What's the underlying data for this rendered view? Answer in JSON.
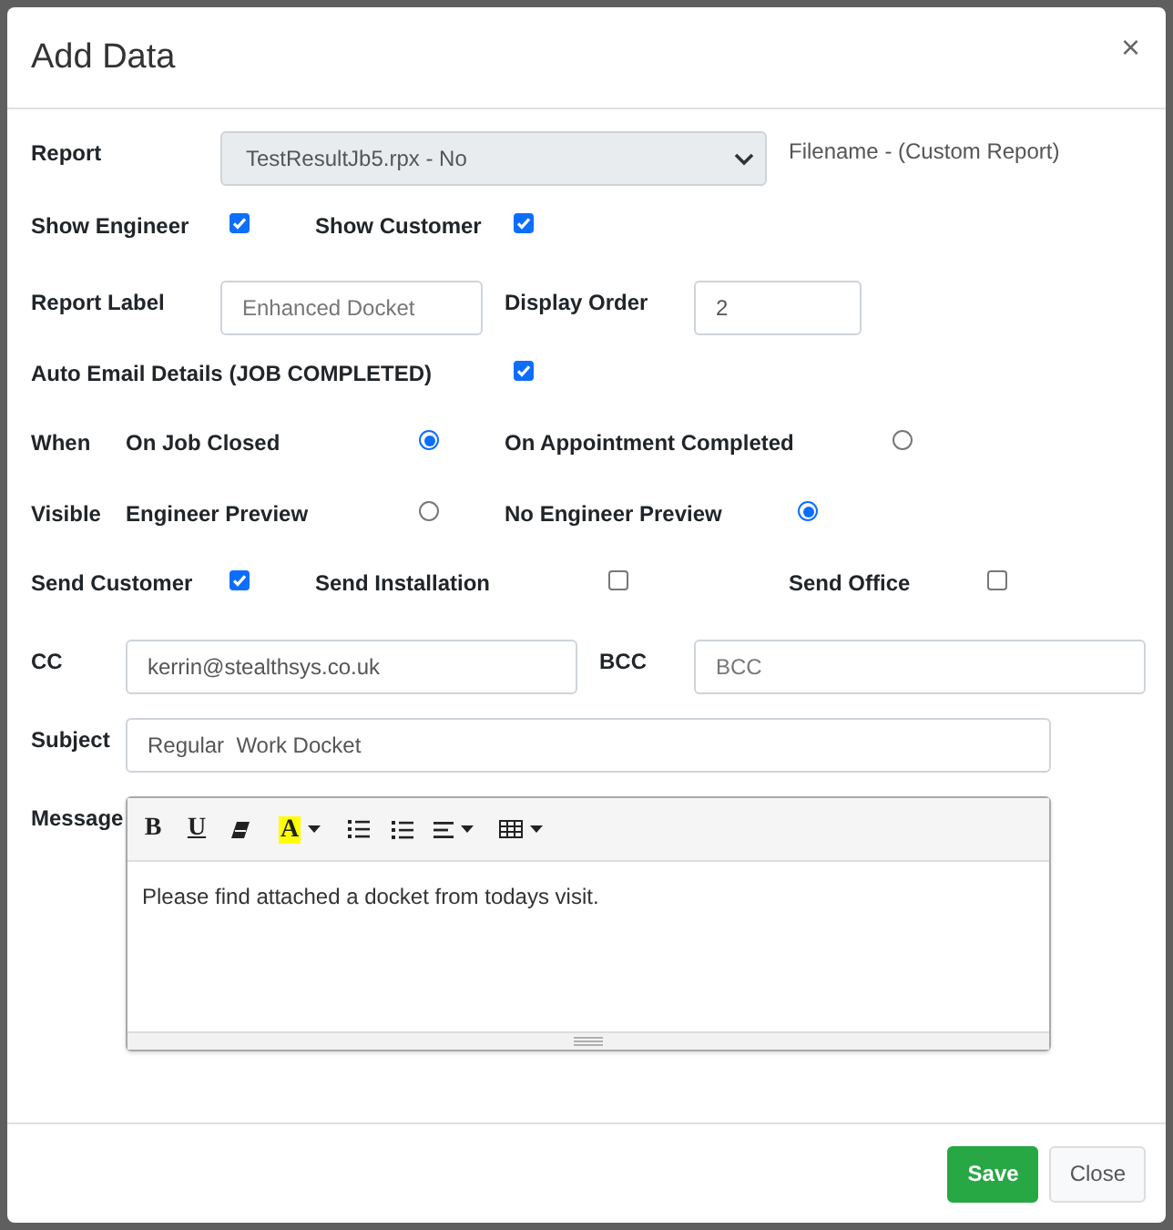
{
  "dialog": {
    "title": "Add Data",
    "close": "×"
  },
  "report": {
    "label": "Report",
    "value": "TestResultJb5.rpx - No",
    "note": "Filename - (Custom Report)"
  },
  "show_engineer": {
    "label": "Show Engineer",
    "checked": true
  },
  "show_customer": {
    "label": "Show Customer",
    "checked": true
  },
  "report_label": {
    "label": "Report Label",
    "placeholder": "Enhanced Docket"
  },
  "display_order": {
    "label": "Display Order",
    "value": "2"
  },
  "auto_email": {
    "label": "Auto Email Details (JOB COMPLETED)",
    "checked": true
  },
  "when": {
    "label": "When",
    "options": [
      {
        "label": "On Job Closed",
        "selected": true
      },
      {
        "label": "On Appointment Completed",
        "selected": false
      }
    ]
  },
  "visible": {
    "label": "Visible",
    "options": [
      {
        "label": "Engineer Preview",
        "selected": false
      },
      {
        "label": "No Engineer Preview",
        "selected": true
      }
    ]
  },
  "send": [
    {
      "label": "Send Customer",
      "checked": true
    },
    {
      "label": "Send Installation",
      "checked": false
    },
    {
      "label": "Send Office",
      "checked": false
    }
  ],
  "cc": {
    "label": "CC",
    "value": "kerrin@stealthsys.co.uk"
  },
  "bcc": {
    "label": "BCC",
    "placeholder": "BCC"
  },
  "subject": {
    "label": "Subject",
    "value": "Regular  Work Docket"
  },
  "message": {
    "label": "Message",
    "toolbar": [
      [
        {
          "kind": "bold",
          "label": "B"
        },
        {
          "kind": "underline",
          "label": "U"
        },
        {
          "kind": "eraser"
        }
      ],
      [
        {
          "kind": "highlight",
          "label": "A"
        }
      ],
      [
        {
          "kind": "bullets"
        },
        {
          "kind": "numbers"
        },
        {
          "kind": "align"
        }
      ],
      [
        {
          "kind": "table"
        }
      ]
    ],
    "body": "Please find attached a docket from todays visit."
  },
  "buttons": [
    {
      "label": "Save",
      "kind": "primary"
    },
    {
      "label": "Close",
      "kind": "secondary"
    }
  ]
}
